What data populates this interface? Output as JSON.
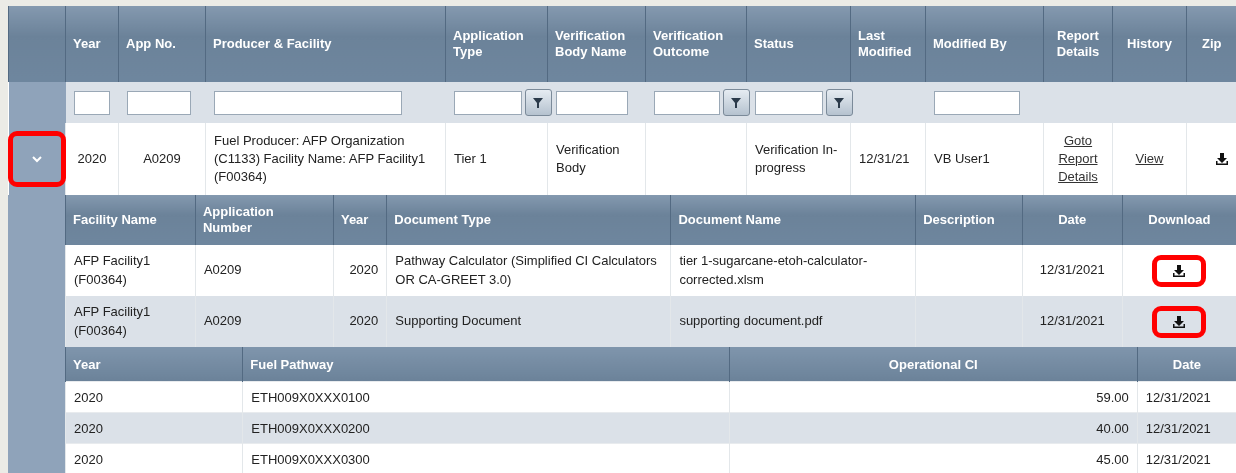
{
  "main_table": {
    "columns": [
      {
        "label": "Year",
        "filter_field": true,
        "filter_button": false
      },
      {
        "label": "App No.",
        "filter_field": true,
        "filter_button": false
      },
      {
        "label": "Producer & Facility",
        "filter_field": true,
        "filter_button": false
      },
      {
        "label": "Application Type",
        "filter_field": true,
        "filter_button": true
      },
      {
        "label": "Verification Body Name",
        "filter_field": true,
        "filter_button": false
      },
      {
        "label": "Verification Outcome",
        "filter_field": true,
        "filter_button": true
      },
      {
        "label": "Status",
        "filter_field": true,
        "filter_button": true
      },
      {
        "label": "Last Modified",
        "filter_field": false,
        "filter_button": false
      },
      {
        "label": "Modified By",
        "filter_field": true,
        "filter_button": false
      },
      {
        "label": "Report Details",
        "filter_field": false,
        "filter_button": false
      },
      {
        "label": "History",
        "filter_field": false,
        "filter_button": false
      },
      {
        "label": "Zip",
        "filter_field": false,
        "filter_button": false
      }
    ],
    "rows": [
      {
        "expanded": true,
        "highlighted": true,
        "cells": [
          {
            "kind": "text",
            "text": "2020"
          },
          {
            "kind": "text",
            "text": "A0209"
          },
          {
            "kind": "text",
            "text": "Fuel Producer: AFP Organization (C1133) Facility Name: AFP Facility1 (F00364)"
          },
          {
            "kind": "text",
            "text": "Tier 1"
          },
          {
            "kind": "text",
            "text": "Verification Body"
          },
          {
            "kind": "text",
            "text": ""
          },
          {
            "kind": "text",
            "text": "Verification In-progress"
          },
          {
            "kind": "text",
            "text": "12/31/21"
          },
          {
            "kind": "text",
            "text": "VB User1"
          },
          {
            "kind": "link",
            "text": "Goto Report Details"
          },
          {
            "kind": "link",
            "text": "View"
          },
          {
            "kind": "download",
            "highlighted": false
          }
        ]
      }
    ]
  },
  "documents_table": {
    "columns": [
      "Facility Name",
      "Application Number",
      "Year",
      "Document Type",
      "Document Name",
      "Description",
      "Date",
      "Download"
    ],
    "rows": [
      {
        "facility": "AFP Facility1 (F00364)",
        "application": "A0209",
        "year": "2020",
        "type": "Pathway Calculator (Simplified CI Calculators OR CA-GREET 3.0)",
        "name": "tier 1-sugarcane-etoh-calculator-corrected.xlsm",
        "date": "12/31/2021",
        "highlighted": true
      },
      {
        "facility": "AFP Facility1 (F00364)",
        "application": "A0209",
        "year": "2020",
        "type": "Supporting Document",
        "name": "supporting document.pdf",
        "date": "12/31/2021",
        "highlighted": true
      }
    ]
  },
  "pathways_table": {
    "columns": [
      "Year",
      "Fuel Pathway",
      "Operational CI",
      "Date"
    ],
    "rows": [
      {
        "year": "2020",
        "pathway": "ETH009X0XXX0100",
        "ci": "59.00",
        "date": "12/31/2021"
      },
      {
        "year": "2020",
        "pathway": "ETH009X0XXX0200",
        "ci": "40.00",
        "date": "12/31/2021"
      },
      {
        "year": "2020",
        "pathway": "ETH009X0XXX0300",
        "ci": "45.00",
        "date": "12/31/2021"
      }
    ]
  }
}
